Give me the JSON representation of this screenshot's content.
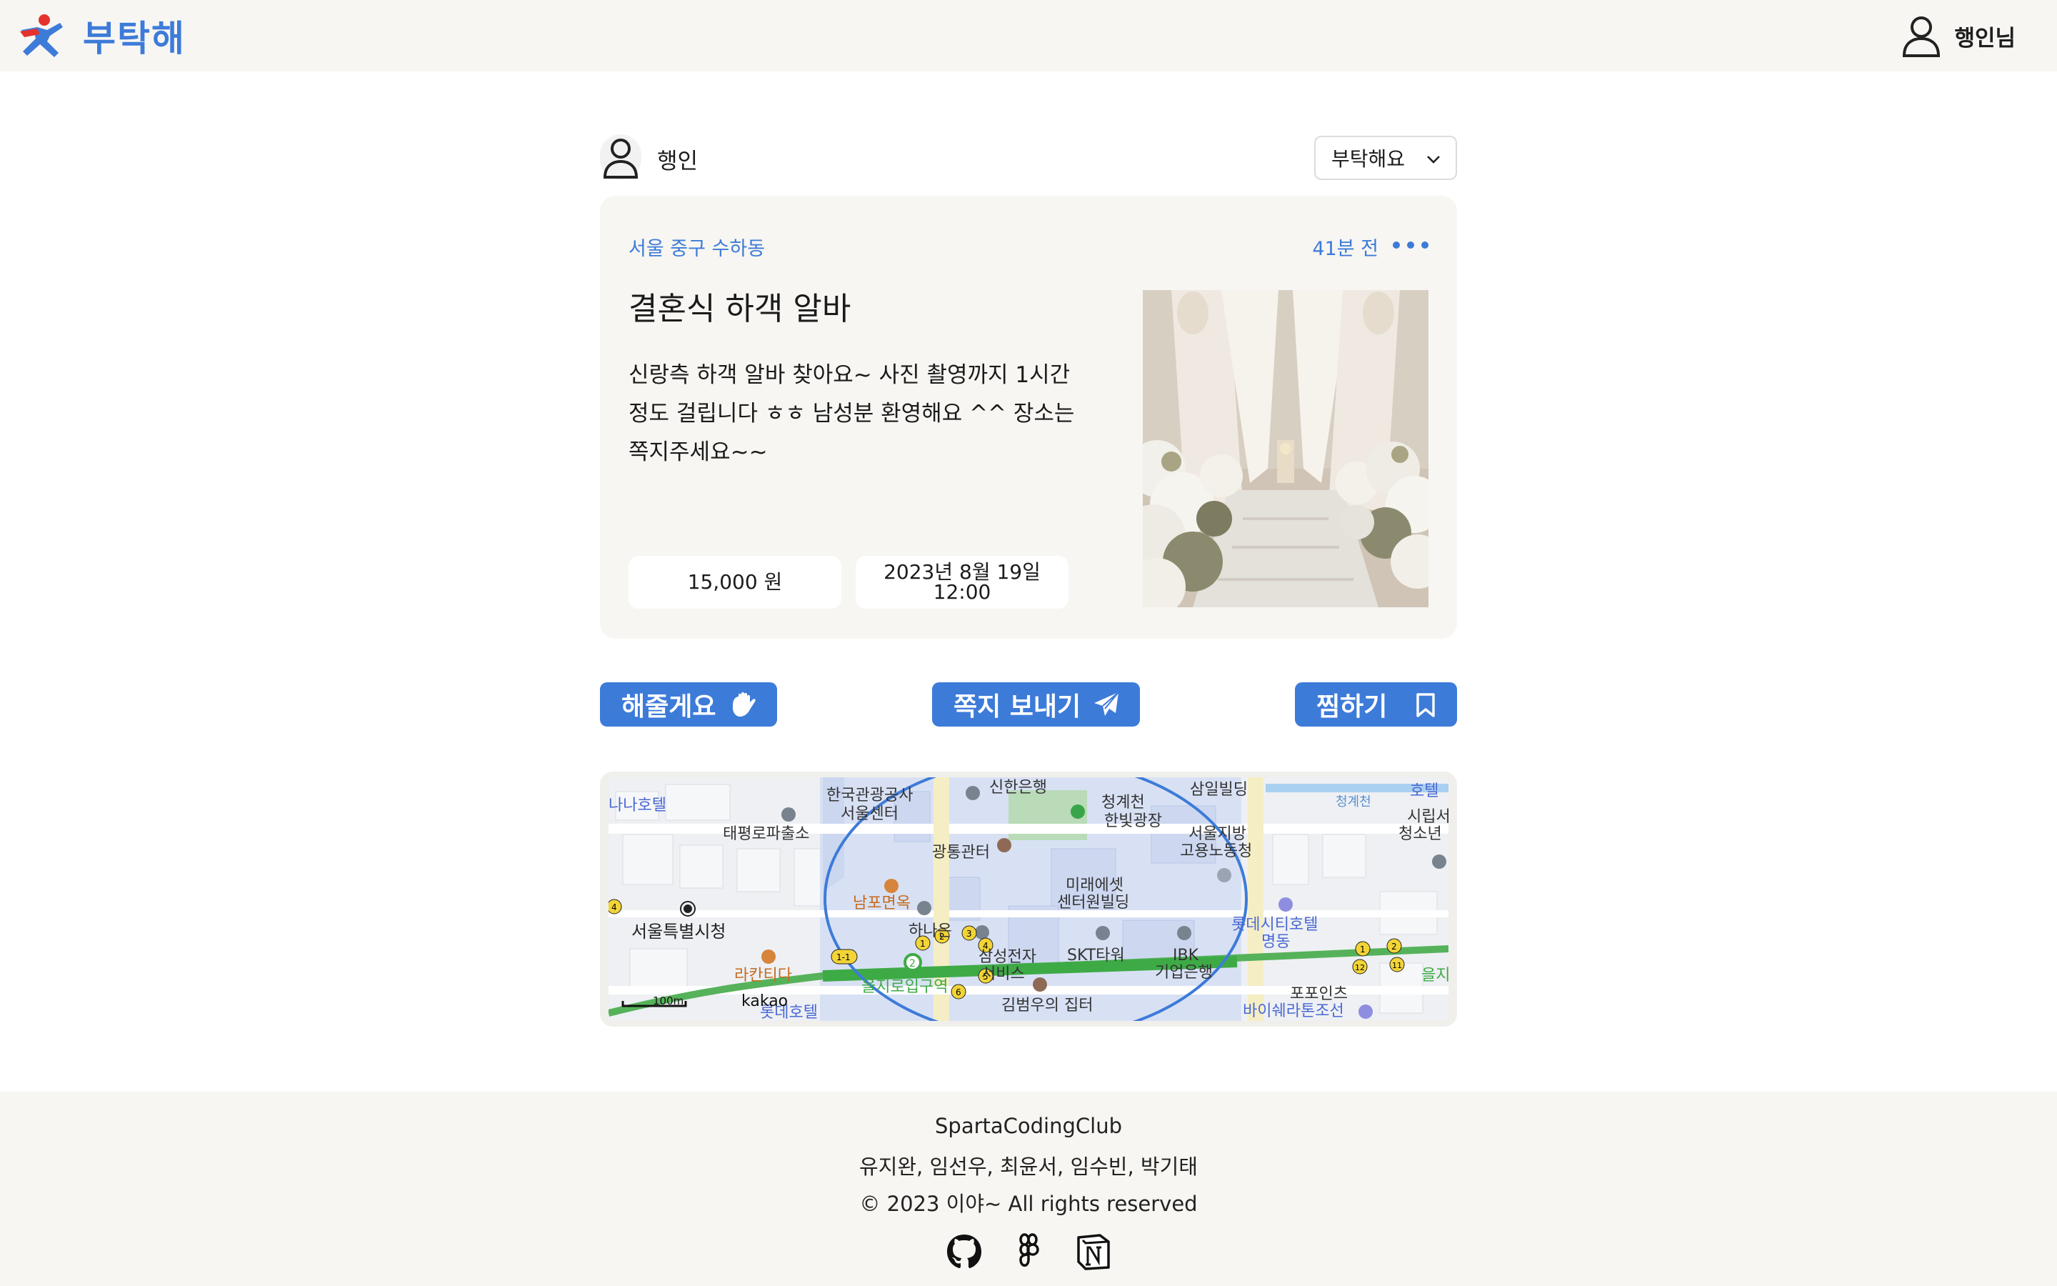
{
  "app": {
    "name": "부탁해",
    "user_menu_name": "행인님",
    "brand_color": "#3d7bd9"
  },
  "post": {
    "author": "행인",
    "category_select": "부탁해요",
    "location": "서울 중구 수하동",
    "time_ago": "41분 전",
    "title": "결혼식 하객 알바",
    "body": "신랑측 하객 알바 찾아요~ 사진 촬영까지 1시간 정도 걸립니다 ㅎㅎ 남성분 환영해요 ^^ 장소는 쪽지주세요~~",
    "price": "15,000 원",
    "date": "2023년 8월 19일",
    "time": "12:00"
  },
  "actions": {
    "help_label": "해줄게요",
    "message_label": "쪽지 보내기",
    "bookmark_label": "찜하기"
  },
  "map": {
    "labels": {
      "l1": "한국관광공사",
      "l2": "서울센터",
      "l3": "신한은행",
      "l4": "청계천",
      "l5": "한빛광장",
      "l6": "삼일빌딩",
      "l7": "청계천",
      "l8": "호텔",
      "l9": "나나호텔",
      "l10": "태평로파출소",
      "l11": "광통관터",
      "l12": "서울지방",
      "l13": "고용노동청",
      "l14": "시립서",
      "l15": "청소년",
      "l16": "남포면옥",
      "l17": "미래에셋",
      "l18": "센터원빌딩",
      "l19": "서울특별시청",
      "l20": "하나은",
      "l21": "삼성전자",
      "l22": "서비스",
      "l23": "SKT타워",
      "l24": "IBK",
      "l25": "기업은행",
      "l26": "롯데시티호텔",
      "l27": "명동",
      "l28": "라칸티다",
      "l29": "을지로입구역",
      "l30": "김범우의 집터",
      "l31": "포포인츠",
      "l32": "바이쉐라톤조선",
      "l33": "롯데호텔",
      "l34": "을지",
      "l35": "1-1",
      "scale": "100m",
      "provider": "kakao"
    }
  },
  "footer": {
    "org": "SpartaCodingClub",
    "members": "유지완, 임선우, 최윤서, 임수빈, 박기태",
    "copyright": "© 2023 이야~ All rights reserved"
  }
}
